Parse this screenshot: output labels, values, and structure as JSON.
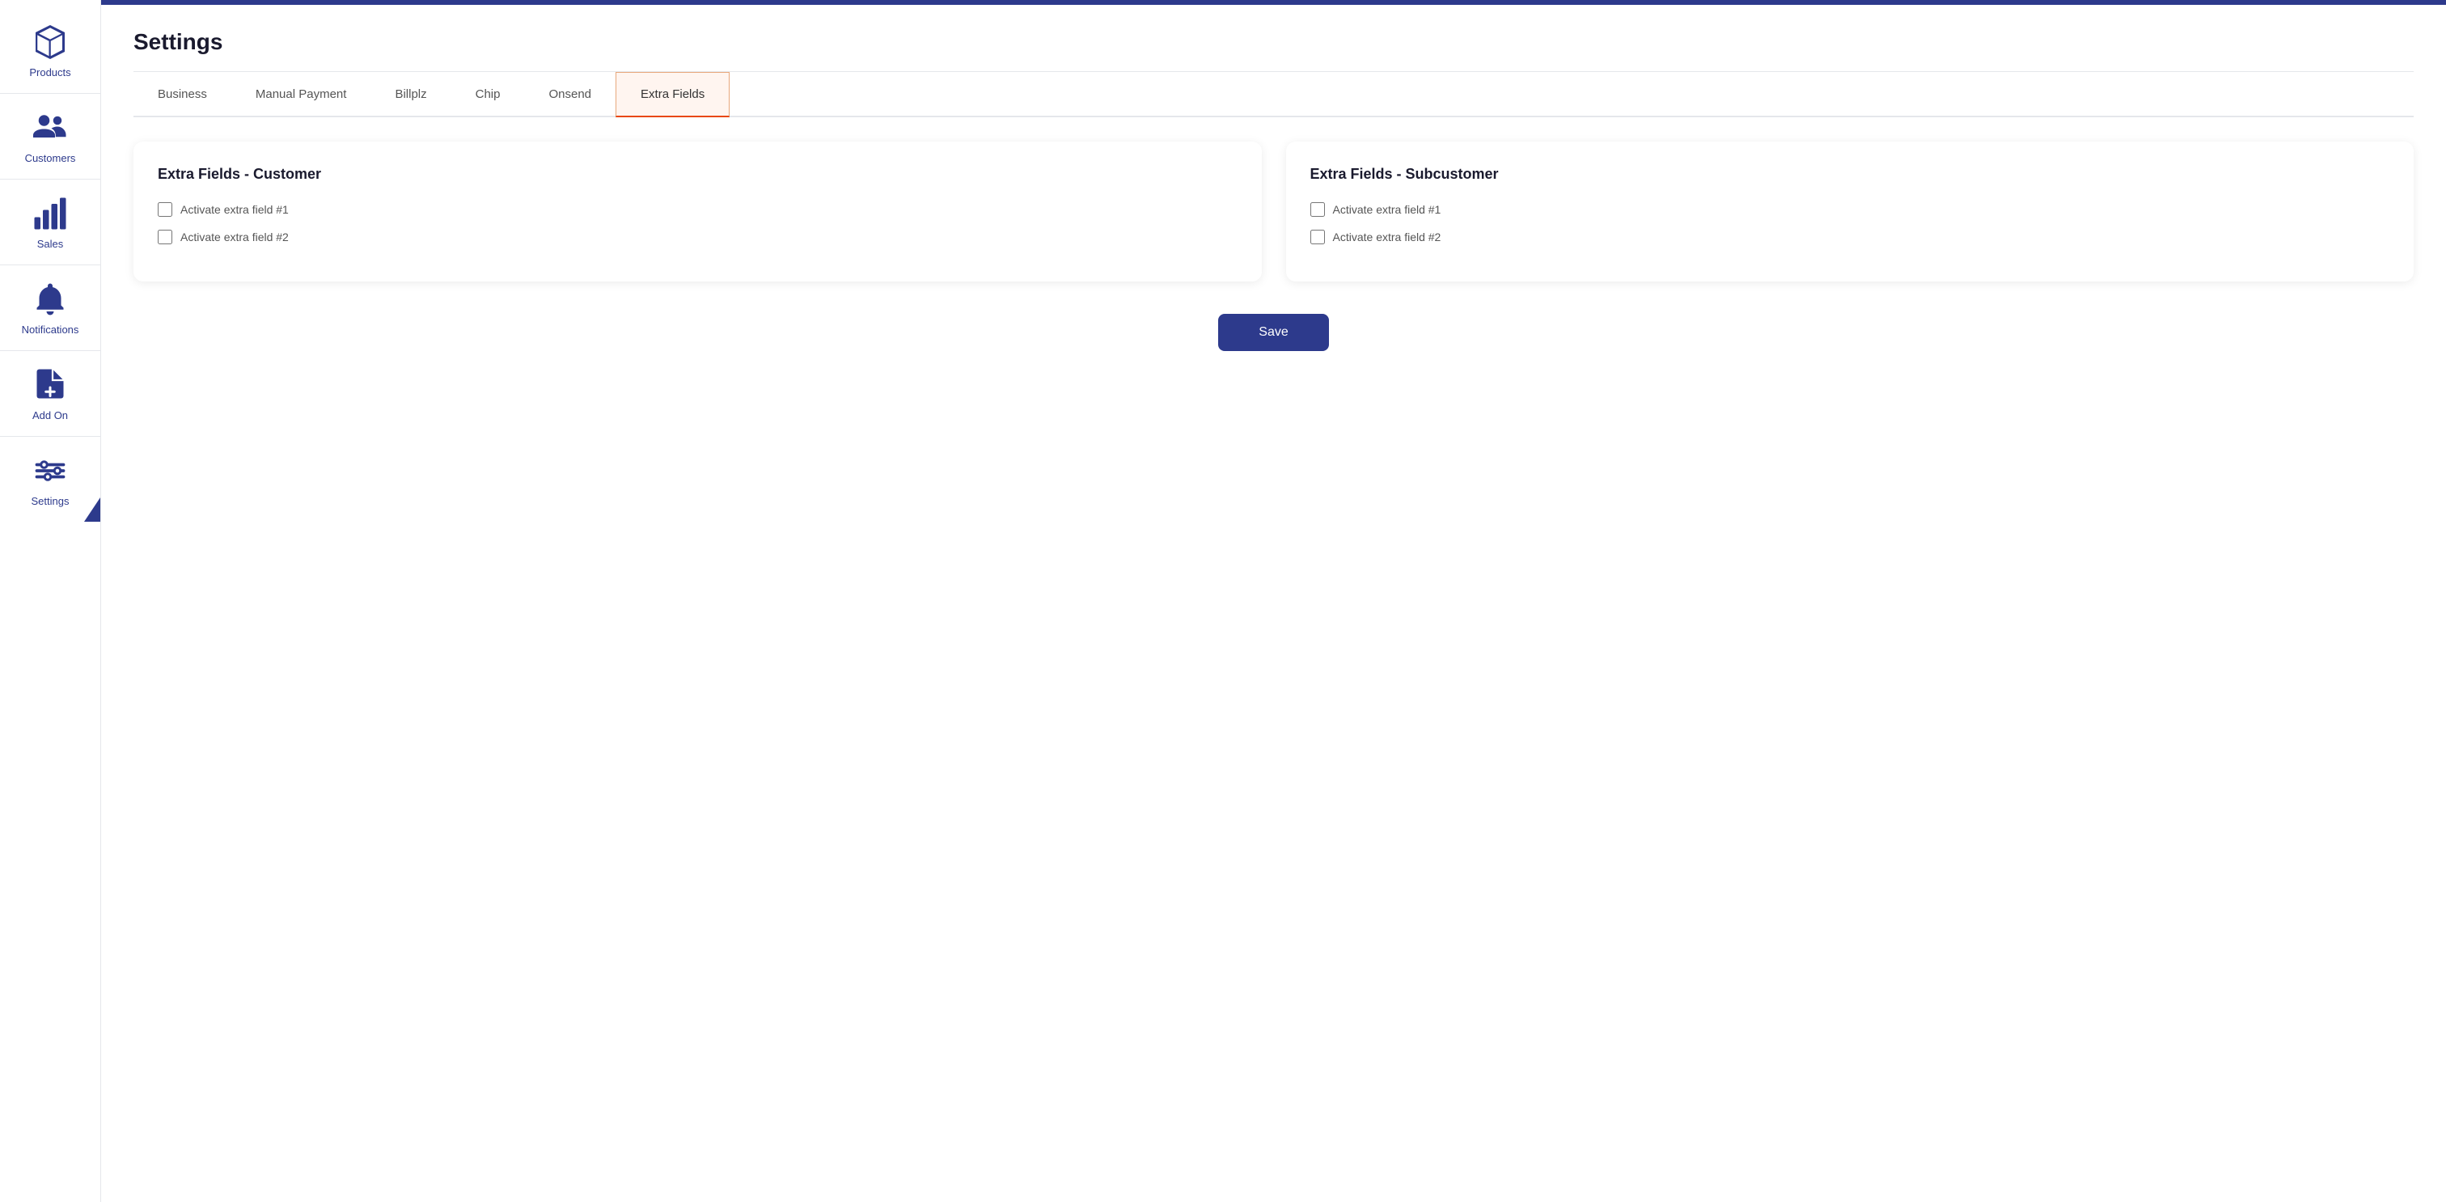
{
  "topbar": {
    "color": "#2d3a8c"
  },
  "sidebar": {
    "items": [
      {
        "id": "products",
        "label": "Products",
        "icon": "box-icon"
      },
      {
        "id": "customers",
        "label": "Customers",
        "icon": "customers-icon"
      },
      {
        "id": "sales",
        "label": "Sales",
        "icon": "sales-icon"
      },
      {
        "id": "notifications",
        "label": "Notifications",
        "icon": "bell-icon"
      },
      {
        "id": "addon",
        "label": "Add On",
        "icon": "addon-icon"
      },
      {
        "id": "settings",
        "label": "Settings",
        "icon": "settings-icon",
        "active": true
      }
    ]
  },
  "page": {
    "title": "Settings"
  },
  "tabs": [
    {
      "id": "business",
      "label": "Business",
      "active": false
    },
    {
      "id": "manual-payment",
      "label": "Manual Payment",
      "active": false
    },
    {
      "id": "billplz",
      "label": "Billplz",
      "active": false
    },
    {
      "id": "chip",
      "label": "Chip",
      "active": false
    },
    {
      "id": "onsend",
      "label": "Onsend",
      "active": false
    },
    {
      "id": "extra-fields",
      "label": "Extra Fields",
      "active": true
    }
  ],
  "cards": [
    {
      "id": "customer-card",
      "title": "Extra Fields - Customer",
      "checkboxes": [
        {
          "id": "customer-field-1",
          "label": "Activate extra field #1",
          "checked": false
        },
        {
          "id": "customer-field-2",
          "label": "Activate extra field #2",
          "checked": false
        }
      ]
    },
    {
      "id": "subcustomer-card",
      "title": "Extra Fields - Subcustomer",
      "checkboxes": [
        {
          "id": "subcustomer-field-1",
          "label": "Activate extra field #1",
          "checked": false
        },
        {
          "id": "subcustomer-field-2",
          "label": "Activate extra field #2",
          "checked": false
        }
      ]
    }
  ],
  "save_button": {
    "label": "Save"
  }
}
